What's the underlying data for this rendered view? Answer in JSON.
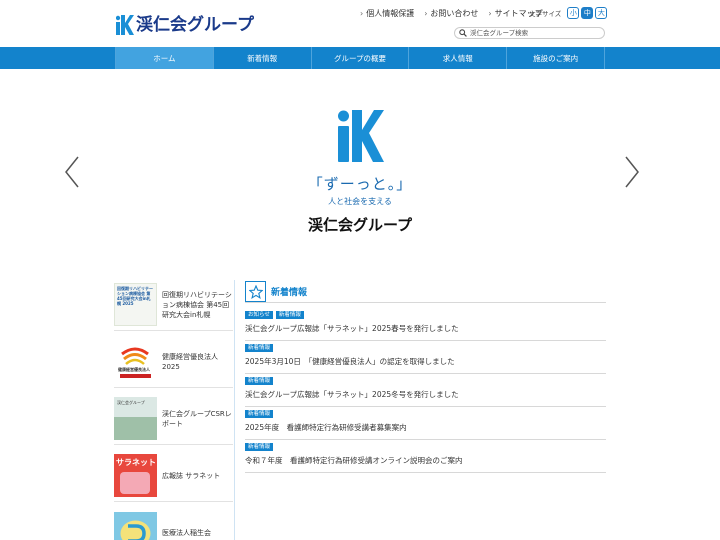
{
  "header": {
    "logo_text": "渓仁会グループ",
    "links": [
      "個人情報保護",
      "お問い合わせ",
      "サイトマップ"
    ],
    "font_size_label": "文字サイズ",
    "font_sizes": [
      "小",
      "中",
      "大"
    ],
    "search_placeholder": "渓仁会グループ検索"
  },
  "nav": {
    "items": [
      "ホーム",
      "新着情報",
      "グループの概要",
      "求人情報",
      "施設のご案内"
    ]
  },
  "hero": {
    "slogan": "「ずーっと。」",
    "subslogan": "人と社会を支える",
    "name": "渓仁会グループ"
  },
  "sidebar": {
    "banners": [
      {
        "text": "回復期リハビリテーション病棟協会 第45回研究大会in札幌",
        "thumb_text": "回復期リハビリテーション病棟協会 第45回研究大会in札幌 2025"
      },
      {
        "text": "健康経営優良法人2025",
        "thumb_text": "健康経営優良法人"
      },
      {
        "text": "渓仁会グループCSRレポート",
        "thumb_text": "渓仁会グループ"
      },
      {
        "text": "広報誌 サラネット",
        "thumb_text": "サラネット"
      },
      {
        "text": "医療法人稲生会",
        "thumb_text": ""
      }
    ]
  },
  "news": {
    "title": "新着情報",
    "items": [
      {
        "tags": [
          "お知らせ",
          "新着情報"
        ],
        "text": "渓仁会グループ広報誌「サラネット」2025春号を発行しました"
      },
      {
        "tags": [
          "新着情報"
        ],
        "text": "2025年3月10日　「健康経営優良法人」の認定を取得しました"
      },
      {
        "tags": [
          "新着情報"
        ],
        "text": "渓仁会グループ広報誌「サラネット」2025冬号を発行しました"
      },
      {
        "tags": [
          "新着情報"
        ],
        "text": "2025年度　看護師特定行為研修受講者募集案内"
      },
      {
        "tags": [
          "新着情報"
        ],
        "text": "令和７年度　看護師特定行為研修受講オンライン説明会のご案内"
      }
    ]
  },
  "colors": {
    "brand_blue": "#1383cc",
    "nav_active": "#42a3e0",
    "logo_navy": "#1a3a8a"
  }
}
